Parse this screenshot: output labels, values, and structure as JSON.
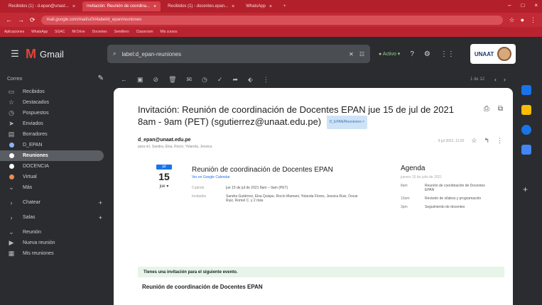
{
  "browser": {
    "tabs": [
      {
        "label": "Recibidos (1) - d.epan@unast..."
      },
      {
        "label": "Invitación: Reunión de coordina..."
      },
      {
        "label": "Recibidos (1) - docentes.epan..."
      },
      {
        "label": "WhatsApp"
      }
    ],
    "url": "mail.google.com/mail/u/0/#label/d_epan/reuniones",
    "bookmarks": [
      "Aplicaciones",
      "WhatsApp",
      "SGAC",
      "Mi Drive",
      "Docentes",
      "Semillero",
      "Classroom",
      "Mis cursos"
    ]
  },
  "gmail": {
    "app_name": "Gmail",
    "search_value": "label:d_epan-reuniones",
    "status": "Activo",
    "org": "UNAAT"
  },
  "sidebar": {
    "compose": "Correo",
    "items": [
      {
        "label": "Recibidos",
        "icon": "inbox-icon"
      },
      {
        "label": "Destacados",
        "icon": "star-icon"
      },
      {
        "label": "Pospuestos",
        "icon": "clock-icon"
      },
      {
        "label": "Enviados",
        "icon": "send-icon"
      },
      {
        "label": "Borradores",
        "icon": "draft-icon"
      },
      {
        "label": "D_EPAN",
        "icon": "label-icon"
      },
      {
        "label": "Reuniones",
        "icon": "label-icon"
      },
      {
        "label": "DOCENCIA",
        "icon": "label-icon"
      },
      {
        "label": "Virtual",
        "icon": "label-icon"
      },
      {
        "label": "Más",
        "icon": "chevron-down-icon"
      }
    ],
    "chat": "Chatear",
    "spaces": "Salas",
    "meet": "Reunión",
    "meet_items": [
      "Nueva reunión",
      "Mis reuniones"
    ]
  },
  "toolbar": {
    "count": "1 de 12",
    "prev": "‹",
    "next": "›"
  },
  "email": {
    "subject": "Invitación: Reunión de coordinación de Docentes EPAN jue 15 de jul de 2021 8am - 9am (PET) (sgutierrez@unaat.edu.pe)",
    "label_chip": "D_EPAN/Reuniones ×",
    "sender": "d_epan@unaat.edu.pe",
    "to": "para mí, Sandra, Elsa, Rocío, Yolanda, Jessica",
    "date": "9 jul 2021, 11:02"
  },
  "event": {
    "month": "jul",
    "day": "15",
    "day_of_week": "jue",
    "title": "Reunión de coordinación de Docentes EPAN",
    "link": "Ver en Google Calendar",
    "when_label": "Cuándo",
    "when": "jue 15 de jul de 2021 8am – 9am (PET)",
    "who_label": "Invitados",
    "who": "Sandra Gutiérrez, Elsa Quispe, Rocío Mamani, Yolanda Flores, Jessica Ruiz, Oscar Ruiz, Romel C. y 2 más"
  },
  "agenda": {
    "title": "Agenda",
    "subtitle": "jueves 15 de julio de 2021",
    "rows": [
      {
        "time": "8am",
        "event": "Reunión de coordinación de Docentes EPAN"
      },
      {
        "time": "10am",
        "event": "Revisión de sílabos y programación"
      },
      {
        "time": "3pm",
        "event": "Seguimiento de docentes"
      }
    ]
  },
  "banner": "Tienes una invitación para el siguiente evento.",
  "footer_title": "Reunión de coordinación de Docentes EPAN"
}
